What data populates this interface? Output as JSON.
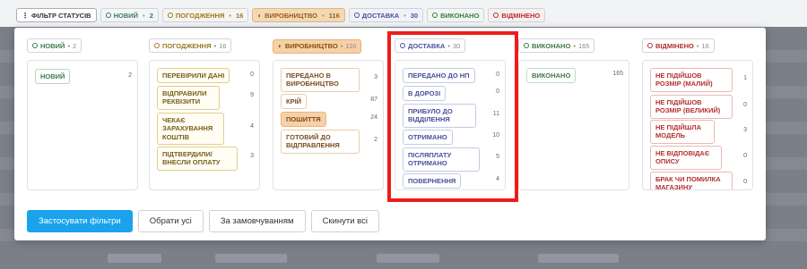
{
  "tabs": [
    {
      "key": "filter",
      "label": "ФІЛЬТР СТАТУСІВ",
      "count": "",
      "icon": "filter-icon"
    },
    {
      "key": "new",
      "label": "НОВИЙ",
      "count": "2",
      "icon": "circle-icon"
    },
    {
      "key": "agree",
      "label": "ПОГОДЖЕННЯ",
      "count": "16",
      "icon": "circle-icon"
    },
    {
      "key": "prod",
      "label": "ВИРОБНИЦТВО",
      "count": "116",
      "icon": "half-circle-icon"
    },
    {
      "key": "del",
      "label": "ДОСТАВКА",
      "count": "30",
      "icon": "circle-icon"
    },
    {
      "key": "done",
      "label": "ВИКОНАНО",
      "count": "",
      "icon": "circle-icon"
    },
    {
      "key": "cancel",
      "label": "ВІДМІНЕНО",
      "count": "",
      "icon": "circle-icon"
    }
  ],
  "columns": {
    "new": {
      "title": "НОВИЙ",
      "count": "2",
      "items": [
        {
          "label": "НОВИЙ",
          "count": "2"
        }
      ]
    },
    "agree": {
      "title": "ПОГОДЖЕННЯ",
      "count": "16",
      "items": [
        {
          "label": "ПЕРЕВІРИЛИ ДАНІ",
          "count": "0"
        },
        {
          "label": "ВІДПРАВИЛИ РЕКВІЗИТИ",
          "count": "9"
        },
        {
          "label": "ЧЕКАЄ ЗАРАХУВАННЯ КОШТІВ",
          "count": "4"
        },
        {
          "label": "ПІДТВЕРДИЛИ/ ВНЕСЛИ ОПЛАТУ",
          "count": "3"
        }
      ]
    },
    "prod": {
      "title": "ВИРОБНИЦТВО",
      "count": "116",
      "items": [
        {
          "label": "ПЕРЕДАНО В ВИРОБНИЦТВО",
          "count": "3"
        },
        {
          "label": "КРІЙ",
          "count": "87"
        },
        {
          "label": "ПОШИТТЯ",
          "count": "24"
        },
        {
          "label": "ГОТОВИЙ ДО ВІДПРАВЛЕННЯ",
          "count": "2"
        }
      ]
    },
    "del": {
      "title": "ДОСТАВКА",
      "count": "30",
      "items": [
        {
          "label": "ПЕРЕДАНО ДО НП",
          "count": "0"
        },
        {
          "label": "В ДОРОЗІ",
          "count": "0"
        },
        {
          "label": "ПРИБУЛО ДО ВІДДІЛЕННЯ",
          "count": "11"
        },
        {
          "label": "ОТРИМАНО",
          "count": "10"
        },
        {
          "label": "ПІСЛЯПЛАТУ ОТРИМАНО",
          "count": "5"
        },
        {
          "label": "ПОВЕРНЕННЯ",
          "count": "4"
        }
      ]
    },
    "done": {
      "title": "ВИКОНАНО",
      "count": "165",
      "items": [
        {
          "label": "ВИКОНАНО",
          "count": "165"
        }
      ]
    },
    "cancel": {
      "title": "ВІДМІНЕНО",
      "count": "16",
      "items": [
        {
          "label": "НЕ ПІДІЙШОВ РОЗМІР (МАЛИЙ)",
          "count": "1"
        },
        {
          "label": "НЕ ПІДІЙШОВ РОЗМІР (ВЕЛИКИЙ)",
          "count": "0"
        },
        {
          "label": "НЕ ПІДІЙШЛА МОДЕЛЬ",
          "count": "3"
        },
        {
          "label": "НЕ ВІДПОВІДАЄ ОПИСУ",
          "count": "0"
        },
        {
          "label": "БРАК ЧИ ПОМИЛКА МАГАЗИНУ",
          "count": "0"
        }
      ]
    }
  },
  "buttons": {
    "apply": "Застосувати фільтри",
    "select_all": "Обрати усі",
    "default": "За замовчуванням",
    "reset": "Скинути всі"
  },
  "colors": {
    "accent": "#1aa3ec",
    "highlight": "#ee1c1c"
  }
}
